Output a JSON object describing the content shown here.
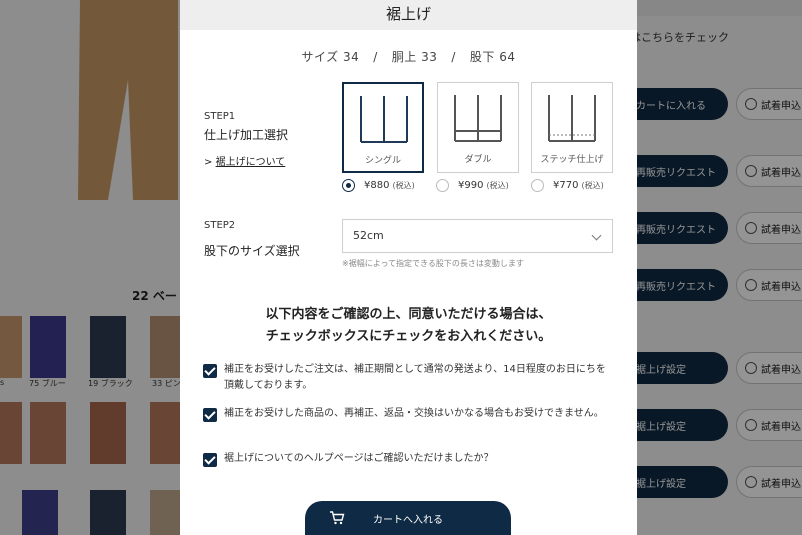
{
  "background": {
    "results_count": "22 ベー",
    "right_link": "はこちらをチェック",
    "thumbs": [
      {
        "caption": "s",
        "color": "#c99a6e"
      },
      {
        "caption": "75 ブルー",
        "color": "#3d3a8c"
      },
      {
        "caption": "19 ブラック",
        "color": "#2d3b52"
      },
      {
        "caption": "33 ピン",
        "color": "#b58f72"
      }
    ],
    "thumbs_row2": [
      {
        "color": "#b5775c"
      },
      {
        "color": "#b5775c"
      },
      {
        "color": "#a8684e"
      },
      {
        "color": "#b5775c"
      }
    ],
    "thumbs_row3": [
      {
        "color": "#3e3e8a"
      },
      {
        "color": "#2d3b52"
      },
      {
        "color": "#c0a98f"
      }
    ],
    "side_buttons": [
      {
        "label": "カートに入れる",
        "try_label": "試着申込"
      },
      {
        "label": "再販売リクエスト",
        "try_label": "試着申込"
      },
      {
        "label": "再販売リクエスト",
        "try_label": "試着申込"
      },
      {
        "label": "再販売リクエスト",
        "try_label": "試着申込"
      },
      {
        "label": "裾上げ設定",
        "try_label": "試着申込"
      },
      {
        "label": "裾上げ設定",
        "try_label": "試着申込"
      },
      {
        "label": "裾上げ設定",
        "try_label": "試着申込"
      }
    ]
  },
  "modal": {
    "title": "裾上げ",
    "size_summary": {
      "size": "サイズ 34",
      "waist": "胴上 33",
      "inseam": "股下 64",
      "separator": "/"
    },
    "step1": {
      "step": "STEP1",
      "title": "仕上げ加工選択",
      "help_prefix": ">",
      "help_link": "裾上げについて",
      "options": [
        {
          "name": "シングル",
          "price": "¥880",
          "tax": "(税込)",
          "selected": true
        },
        {
          "name": "ダブル",
          "price": "¥990",
          "tax": "(税込)",
          "selected": false
        },
        {
          "name": "ステッチ仕上げ",
          "price": "¥770",
          "tax": "(税込)",
          "selected": false
        }
      ]
    },
    "step2": {
      "step": "STEP2",
      "title": "股下のサイズ選択",
      "selected_value": "52cm",
      "note": "※裾幅によって指定できる股下の長さは変動します"
    },
    "confirm": {
      "heading_line1": "以下内容をご確認の上、同意いただける場合は、",
      "heading_line2": "チェックボックスにチェックをお入れください。",
      "items": [
        {
          "text": "補正をお受けしたご注文は、補正期間として通常の発送より、14日程度のお日にちを頂戴しております。",
          "checked": true
        },
        {
          "text": "補正をお受けした商品の、再補正、返品・交換はいかなる場合もお受けできません。",
          "checked": true
        },
        {
          "text": "裾上げについてのヘルプページはご確認いただけましたか？",
          "checked": true
        }
      ]
    },
    "cart_button": "カートへ入れる"
  },
  "colors": {
    "accent_navy": "#0f2a44"
  }
}
